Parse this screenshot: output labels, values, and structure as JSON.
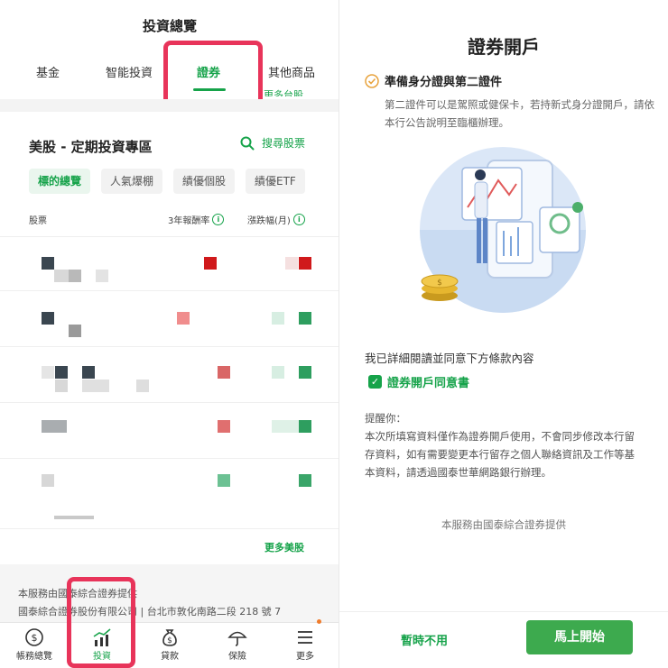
{
  "left": {
    "title": "投資總覽",
    "tabs": [
      "基金",
      "智能投資",
      "證券",
      "其他商品"
    ],
    "more_us_top": "更多台股",
    "section_title": "美股 - 定期投資專區",
    "search_label": "搜尋股票",
    "chips": [
      "標的總覽",
      "人氣爆棚",
      "績優個股",
      "績優ETF"
    ],
    "col_stock": "股票",
    "col_return": "3年報酬率",
    "col_change": "漲跌幅(月)",
    "more_us": "更多美股",
    "footer_line1": "本服務由國泰綜合證券提供",
    "footer_line2": "國泰綜合證券股份有限公司 | 台北市敦化南路二段 218 號 7",
    "nav": [
      "帳務總覽",
      "投資",
      "貸款",
      "保險",
      "更多"
    ]
  },
  "right": {
    "title": "證券開戶",
    "prep_title": "準備身分證與第二證件",
    "prep_desc": "第二證件可以是駕照或健保卡，若持新式身分證開戶，請依本行公告說明至臨櫃辦理。",
    "agree_text": "我已詳細閱讀並同意下方條款內容",
    "consent_label": "證券開戶同意書",
    "remind_title": "提醒你：",
    "remind_body": "本次所填寫資料僅作為證券開戶使用，不會同步修改本行留存資料，如有需要變更本行留存之個人聯絡資訊及工作等基本資料，請透過國泰世華網路銀行辦理。",
    "provided": "本服務由國泰綜合證券提供",
    "btn_later": "暫時不用",
    "btn_start": "馬上開始"
  },
  "colors": {
    "accent": "#16a34a",
    "highlight": "#e8345a",
    "up_red": "#d0191b",
    "down_green": "#2e9e5f"
  }
}
